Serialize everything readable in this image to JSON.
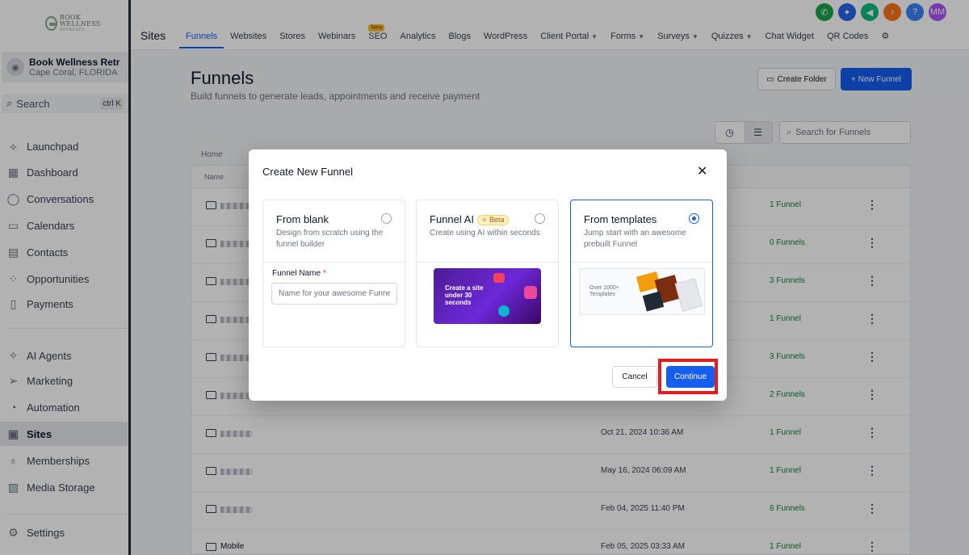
{
  "sidebar": {
    "logo_text": "BOOK WELLNESS",
    "logo_sub": "RETREATS",
    "account": {
      "name": "Book Wellness Retre...",
      "location": "Cape Coral, FLORIDA"
    },
    "search": {
      "label": "Search",
      "shortcut": "ctrl K"
    },
    "items": [
      {
        "label": "Launchpad",
        "icon": "rocket-icon",
        "glyph": "⟡"
      },
      {
        "label": "Dashboard",
        "icon": "dashboard-icon",
        "glyph": "▦"
      },
      {
        "label": "Conversations",
        "icon": "chat-icon",
        "glyph": "◯"
      },
      {
        "label": "Calendars",
        "icon": "calendar-icon",
        "glyph": "▭"
      },
      {
        "label": "Contacts",
        "icon": "contacts-icon",
        "glyph": "▤"
      },
      {
        "label": "Opportunities",
        "icon": "opportunities-icon",
        "glyph": "⁘"
      },
      {
        "label": "Payments",
        "icon": "payments-icon",
        "glyph": "▯"
      },
      {
        "label": "AI Agents",
        "icon": "sparkle-icon",
        "glyph": "✧"
      },
      {
        "label": "Marketing",
        "icon": "send-icon",
        "glyph": "➢"
      },
      {
        "label": "Automation",
        "icon": "automation-icon",
        "glyph": "◔"
      },
      {
        "label": "Sites",
        "icon": "sites-icon",
        "glyph": "▣"
      },
      {
        "label": "Memberships",
        "icon": "badge-icon",
        "glyph": "♁"
      },
      {
        "label": "Media Storage",
        "icon": "image-icon",
        "glyph": "▨"
      },
      {
        "label": "Settings",
        "icon": "gear-icon",
        "glyph": "⚙"
      }
    ]
  },
  "topbar": {
    "section_title": "Sites",
    "tabs": [
      "Funnels",
      "Websites",
      "Stores",
      "Webinars",
      "SEO",
      "Analytics",
      "Blogs",
      "WordPress",
      "Client Portal",
      "Forms",
      "Surveys",
      "Quizzes",
      "Chat Widget",
      "QR Codes"
    ],
    "seo_badge": "New",
    "user_initials": "MM",
    "help_glyph": "?",
    "colors": {
      "phone": "#16a34a",
      "magic": "#2563eb",
      "announce": "#10b981",
      "bell": "#f97316",
      "help": "#3b82f6",
      "avatar": "#a855f7"
    }
  },
  "page": {
    "title": "Funnels",
    "subtitle": "Build funnels to generate leads, appointments and receive payment",
    "create_folder": "Create Folder",
    "new_funnel": "+ New Funnel",
    "search_placeholder": "Search for Funnels",
    "breadcrumb": "Home",
    "col_name": "Name"
  },
  "rows": [
    {
      "name": "",
      "date": "",
      "count": "1 Funnel"
    },
    {
      "name": "",
      "date": "",
      "count": "0 Funnels"
    },
    {
      "name": "",
      "date": "",
      "count": "3 Funnels"
    },
    {
      "name": "",
      "date": "",
      "count": "1 Funnel"
    },
    {
      "name": "",
      "date": "",
      "count": "3 Funnels"
    },
    {
      "name": "",
      "date": "",
      "count": "2 Funnels"
    },
    {
      "name": "",
      "date": "Oct 21, 2024 10:36 AM",
      "count": "1 Funnel"
    },
    {
      "name": "",
      "date": "May 16, 2024 06:09 AM",
      "count": "1 Funnel"
    },
    {
      "name": "",
      "date": "Feb 04, 2025 11:40 PM",
      "count": "6 Funnels"
    },
    {
      "name": "Mobile",
      "date": "Feb 05, 2025 03:33 AM",
      "count": "1 Funnel"
    }
  ],
  "modal": {
    "title": "Create New Funnel",
    "close_glyph": "✕",
    "blank": {
      "title": "From blank",
      "desc": "Design from scratch using the funnel builder",
      "field_label": "Funnel Name",
      "required_mark": "*",
      "placeholder": "Name for your awesome Funnel"
    },
    "ai": {
      "title": "Funnel AI",
      "badge": "Beta",
      "desc": "Create using AI within seconds",
      "preview_text": "Create a site under 30 seconds"
    },
    "templates": {
      "title": "From templates",
      "desc": "Jump start with an awesome prebuilt Funnel",
      "preview_text": "Over 1000+ Templates"
    },
    "selected_option": "From templates",
    "cancel": "Cancel",
    "continue": "Continue"
  }
}
